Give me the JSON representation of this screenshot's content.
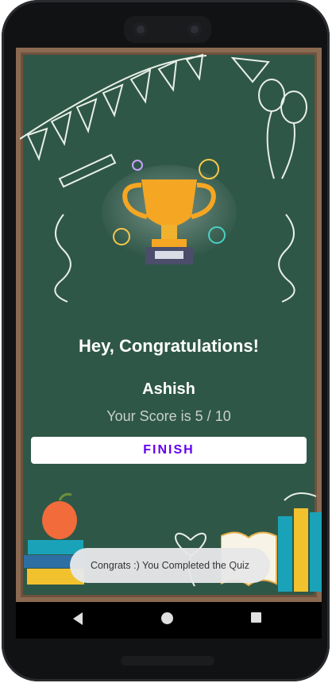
{
  "quiz_result": {
    "title": "Hey, Congratulations!",
    "user_name": "Ashish",
    "score_text": "Your Score is 5 / 10",
    "finish_label": "FINISH"
  },
  "toast": {
    "message": "Congrats :) You Completed the Quiz"
  },
  "colors": {
    "chalkboard": "#2f5747",
    "frame": "#8b6a52",
    "button_text": "#6200ee",
    "trophy_gold": "#f5a623"
  },
  "icons": {
    "trophy": "trophy-icon",
    "balloons": "balloons-icon",
    "bunting": "bunting-icon",
    "books": "books-icon",
    "apple": "apple-icon"
  }
}
